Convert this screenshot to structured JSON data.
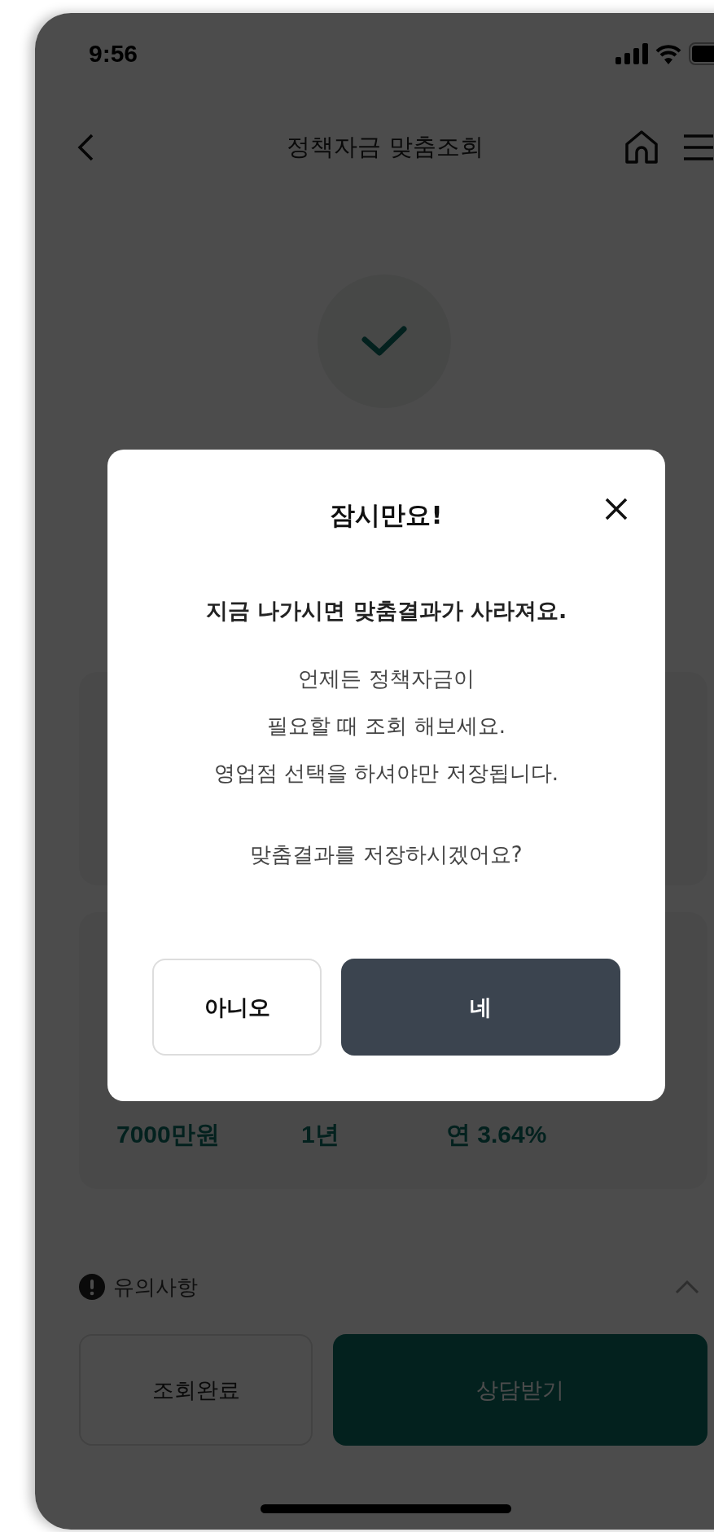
{
  "status_bar": {
    "time": "9:56"
  },
  "nav": {
    "title": "정책자금 맞춤조회"
  },
  "result": {
    "values": [
      "7000만원",
      "1년",
      "연 3.64%"
    ]
  },
  "notice": {
    "label": "유의사항",
    "expanded": true
  },
  "actions": [
    {
      "label": "조회완료",
      "kind": "outline"
    },
    {
      "label": "상담받기",
      "kind": "primary"
    }
  ],
  "dialog": {
    "title": "잠시만요!",
    "subtitle": "지금 나가시면 맞춤결과가 사라져요.",
    "body": [
      "언제든 정책자금이",
      "필요할 때 조회 해보세요.",
      "영업점 선택을 하셔야만 저장됩니다."
    ],
    "question": "맞춤결과를 저장하시겠어요?",
    "buttons": [
      {
        "label": "아니오",
        "kind": "outline"
      },
      {
        "label": "네",
        "kind": "primary"
      }
    ]
  }
}
